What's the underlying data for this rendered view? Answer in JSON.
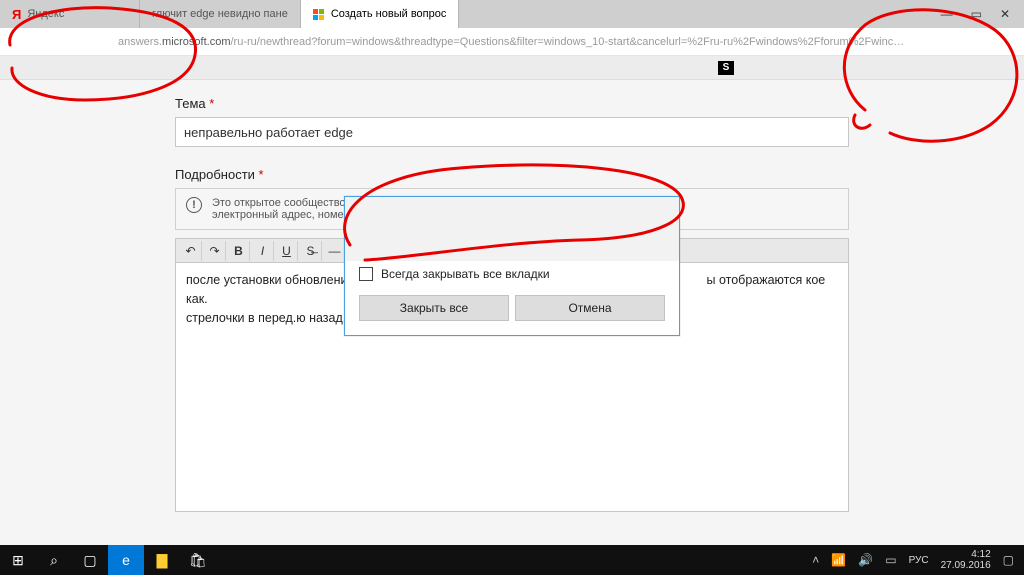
{
  "tabs": [
    {
      "label": "Яндекс",
      "icon": "yandex"
    },
    {
      "label": "глючит edge невидно пане",
      "icon": ""
    },
    {
      "label": "Создать новый вопрос",
      "icon": "microsoft",
      "active": true
    }
  ],
  "window": {
    "min": "—",
    "max": "▭",
    "close": "✕"
  },
  "url": {
    "prefix": "answers.",
    "host": "microsoft.com",
    "path": "/ru-ru/newthread?forum=windows&threadtype=Questions&filter=windows_10-start&cancelurl=%2Fru-ru%2Fwindows%2Fforum%2Fwinc…"
  },
  "toolbar_icon": "S",
  "form": {
    "subject_label": "Тема",
    "subject_value": "неправельно работает edge",
    "details_label": "Подробности",
    "notice_line1": "Это открытое сообщество. Для з",
    "notice_line2": "электронный адрес, номер теле",
    "editor_text_1": "после установки обновления wi",
    "editor_text_2": "ы отображаются кое как.",
    "editor_text_3": "стрелочки в перед.ю назад, обн"
  },
  "dialog": {
    "checkbox_label": "Всегда закрывать все вкладки",
    "close_all": "Закрыть все",
    "cancel": "Отмена"
  },
  "taskbar": {
    "lang": "РУС",
    "time": "4:12",
    "date": "27.09.2016"
  }
}
